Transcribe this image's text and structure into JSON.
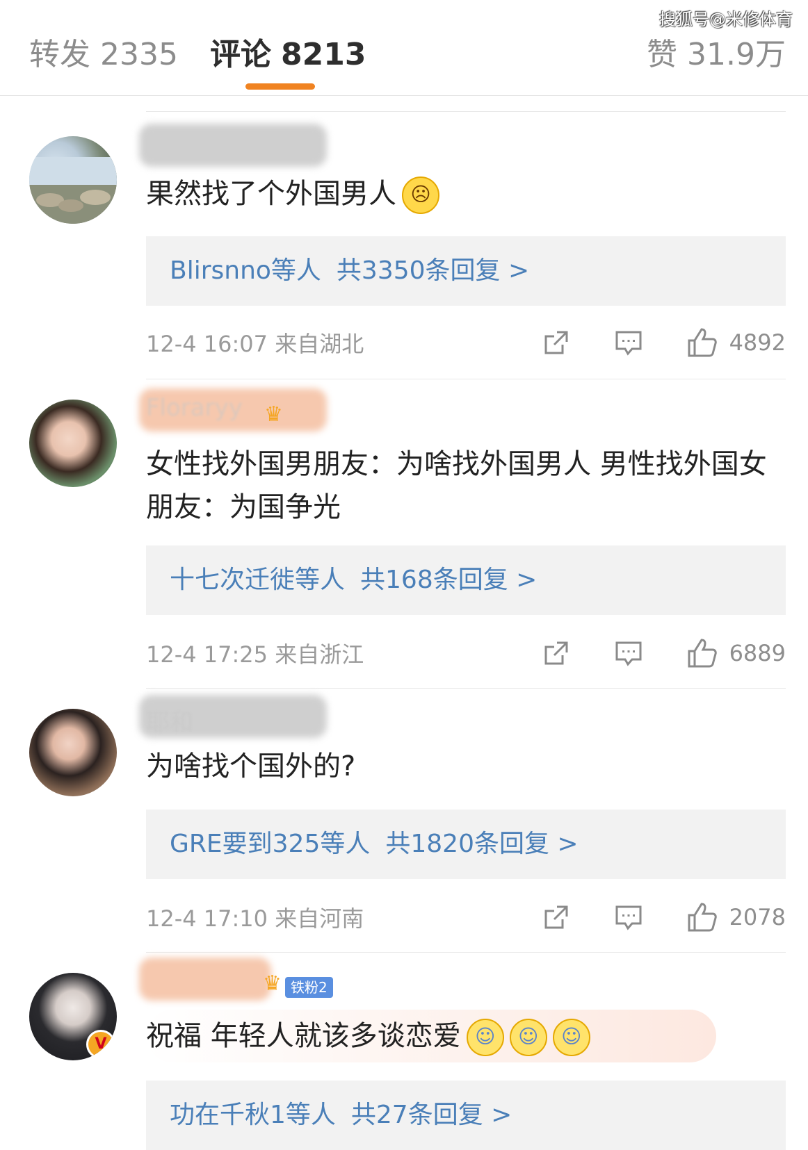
{
  "watermark": "搜狐号@米修体育",
  "tabs": {
    "repost": {
      "label": "转发",
      "count": "2335"
    },
    "comments": {
      "label": "评论",
      "count": "8213"
    },
    "likes": {
      "label": "赞",
      "count": "31.9万"
    }
  },
  "accent_color": "#f08321",
  "link_color": "#4a7fb8",
  "comments": [
    {
      "text": "果然找了个外国男人",
      "emoji": "angry-face-icon",
      "replies": {
        "who": "Blirsnno等人",
        "total": "共3350条回复 >"
      },
      "time": "12-4 16:07",
      "location": "来自湖北",
      "likes": "4892"
    },
    {
      "name": "Floraryy",
      "text": "女性找外国男朋友：为啥找外国男人 男性找外国女朋友：为国争光",
      "replies": {
        "who": "十七次迁徙等人",
        "total": "共168条回复 >"
      },
      "time": "12-4 17:25",
      "location": "来自浙江",
      "likes": "6889"
    },
    {
      "name": "耶和",
      "text": "为啥找个国外的?",
      "replies": {
        "who": "GRE要到325等人",
        "total": "共1820条回复 >"
      },
      "time": "12-4 17:10",
      "location": "来自河南",
      "likes": "2078"
    },
    {
      "fan_badge": "铁粉2",
      "text": "祝福 年轻人就该多谈恋爱",
      "emoji": "laugh-cry-icon",
      "replies": {
        "who": "功在千秋1等人",
        "total": "共27条回复 >"
      }
    }
  ]
}
